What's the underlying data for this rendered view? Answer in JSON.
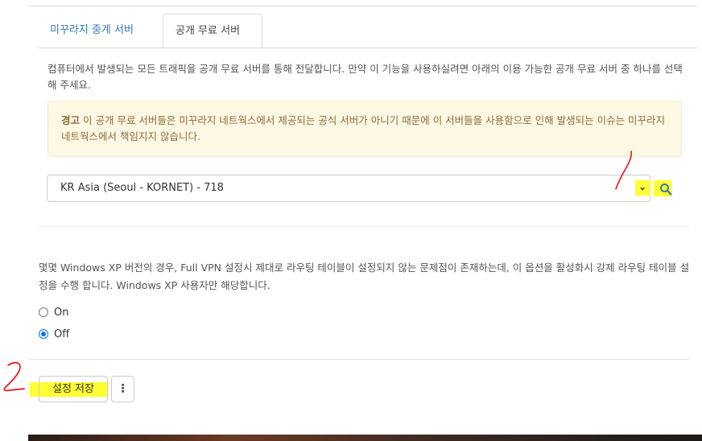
{
  "tabs": [
    {
      "label": "미꾸라지 중계 서버",
      "active": false
    },
    {
      "label": "공개 무료 서버",
      "active": true
    }
  ],
  "description": "컴퓨터에서 발생되는 모든 트래픽을 공개 무료 서버를 통해 전달합니다. 만약 이 기능을 사용하실려면 아래의 이용 가능한 공개 무료 서버 중 하나를 선택해 주세요.",
  "warning": {
    "title": "경고",
    "text": "이 공개 무료 서버들은 미꾸라지 네트웍스에서 제공되는 공식 서버가 아니기 때문에 이 서버들을 사용함으로 인해 발생되는 이슈는 미꾸라지 네트웍스에서 책임지지 않습니다."
  },
  "server_select": {
    "selected": "KR Asia (Seoul - KORNET) - 718",
    "icon": "chevron-down-icon"
  },
  "search_icon": "search-icon",
  "routing": {
    "description": "몇몇 Windows XP 버전의 경우, Full VPN 설정시 제대로 라우팅 테이블이 설정되지 않는 문제점이 존재하는데, 이 옵션을 활성화시 강제 라우팅 테이블 설정을 수행 합니다. Windows XP 사용자만 해당합니다.",
    "options": [
      {
        "label": "On",
        "checked": false
      },
      {
        "label": "Off",
        "checked": true
      }
    ]
  },
  "actions": {
    "save_label": "설정 저장",
    "more_label": "⋮"
  },
  "annotations": {
    "step2_label": "2",
    "highlight_color": "#ffff33",
    "pen_color": "#e8141c"
  }
}
